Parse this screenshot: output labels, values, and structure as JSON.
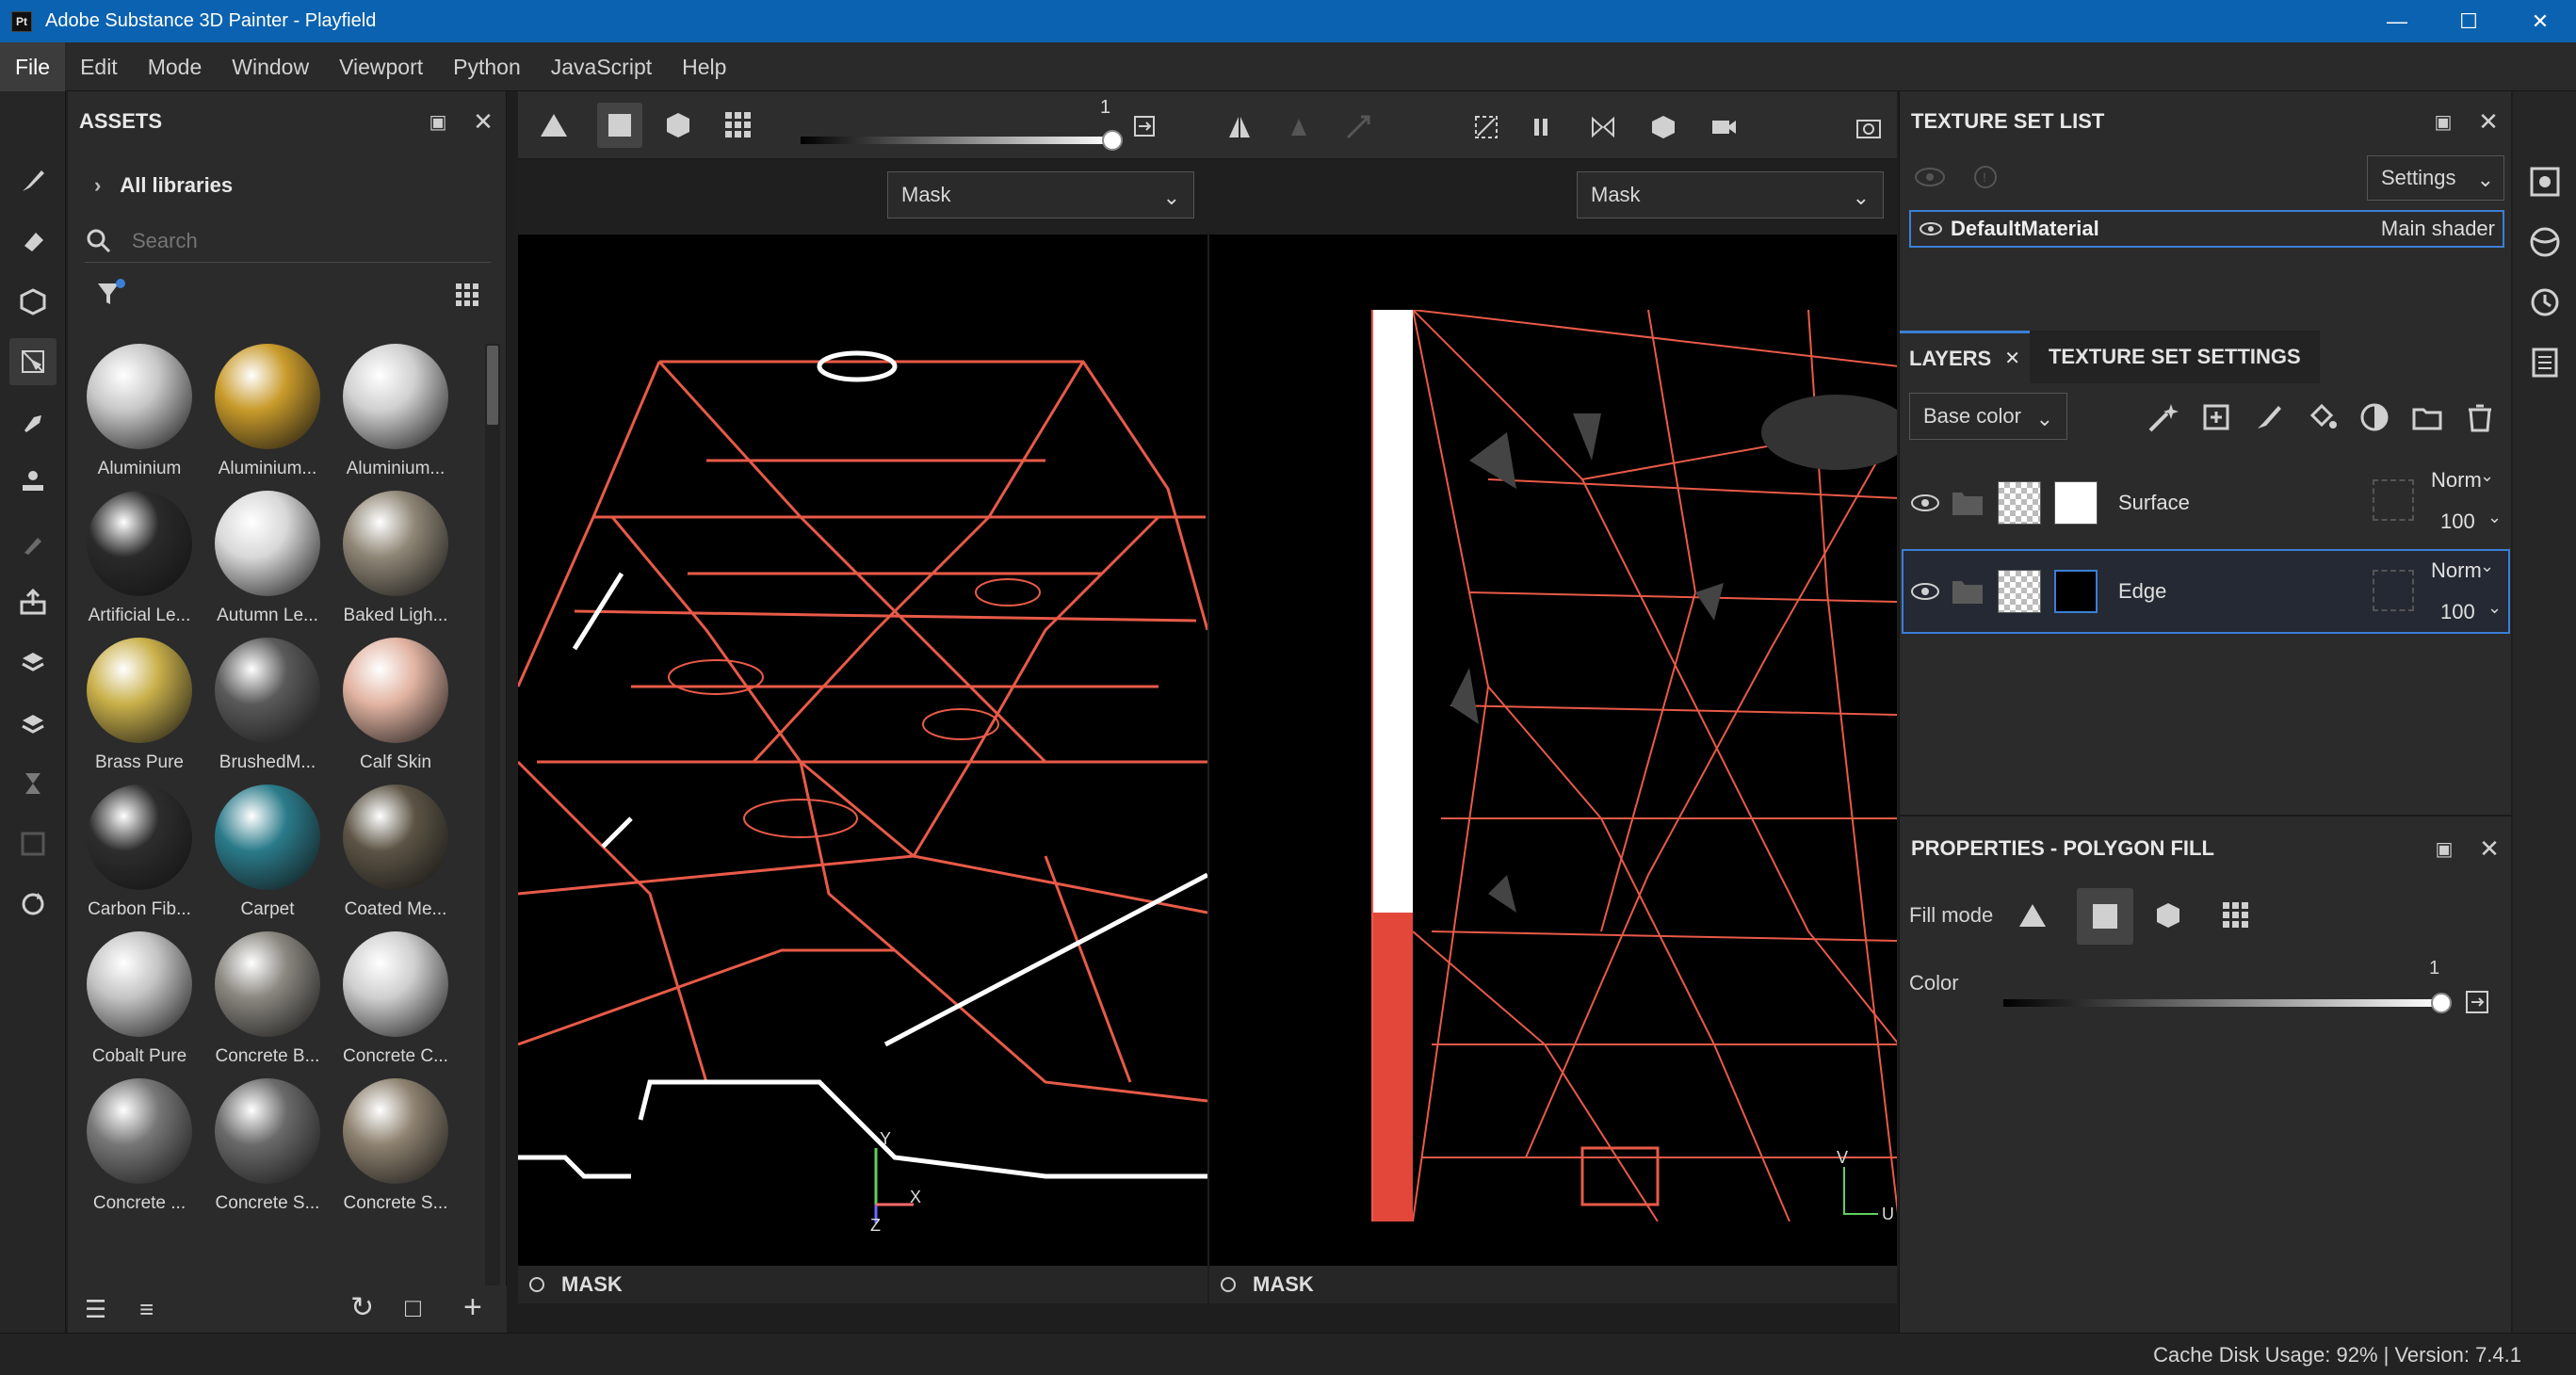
{
  "window": {
    "title": "Adobe Substance 3D Painter - Playfield",
    "app_icon": "Pt"
  },
  "menu": [
    "File",
    "Edit",
    "Mode",
    "Window",
    "Viewport",
    "Python",
    "JavaScript",
    "Help"
  ],
  "assets": {
    "title": "ASSETS",
    "library": "All libraries",
    "search_placeholder": "Search",
    "items": [
      {
        "name": "Aluminium",
        "color": "#c8c8c8"
      },
      {
        "name": "Aluminium...",
        "color": "#c89a2a"
      },
      {
        "name": "Aluminium...",
        "color": "#d0d0d0"
      },
      {
        "name": "Artificial Le...",
        "color": "#2a2a2a"
      },
      {
        "name": "Autumn Le...",
        "color": "#d8d8d8"
      },
      {
        "name": "Baked Ligh...",
        "color": "#8f8676"
      },
      {
        "name": "Brass Pure",
        "color": "#c9b04a"
      },
      {
        "name": "BrushedM...",
        "color": "#5a5a5a"
      },
      {
        "name": "Calf Skin",
        "color": "#e2b4a2"
      },
      {
        "name": "Carbon Fib...",
        "color": "#2d2d2d"
      },
      {
        "name": "Carpet",
        "color": "#2a7b8a"
      },
      {
        "name": "Coated Me...",
        "color": "#5c5445"
      },
      {
        "name": "Cobalt Pure",
        "color": "#c4c4c4"
      },
      {
        "name": "Concrete B...",
        "color": "#8a8780"
      },
      {
        "name": "Concrete C...",
        "color": "#cfcfcf"
      },
      {
        "name": "Concrete ...",
        "color": "#777777"
      },
      {
        "name": "Concrete S...",
        "color": "#6a6a6a"
      },
      {
        "name": "Concrete S...",
        "color": "#8e8270"
      }
    ]
  },
  "viewport": {
    "toolbar_value": "1",
    "left": {
      "channel": "Mask",
      "footer": "MASK"
    },
    "right": {
      "channel": "Mask",
      "footer": "MASK"
    }
  },
  "texture_set_list": {
    "title": "TEXTURE SET LIST",
    "settings_label": "Settings",
    "material": "DefaultMaterial",
    "shader": "Main shader"
  },
  "layers": {
    "tab_layers": "LAYERS",
    "tab_settings": "TEXTURE SET SETTINGS",
    "channel": "Base color",
    "items": [
      {
        "name": "Surface",
        "blend": "Norm",
        "opacity": "100"
      },
      {
        "name": "Edge",
        "blend": "Norm",
        "opacity": "100"
      }
    ]
  },
  "properties": {
    "title": "PROPERTIES - POLYGON FILL",
    "fill_mode_label": "Fill mode",
    "color_label": "Color",
    "color_value": "1"
  },
  "status": {
    "text": "Cache Disk Usage: 92% | Version: 7.4.1"
  }
}
